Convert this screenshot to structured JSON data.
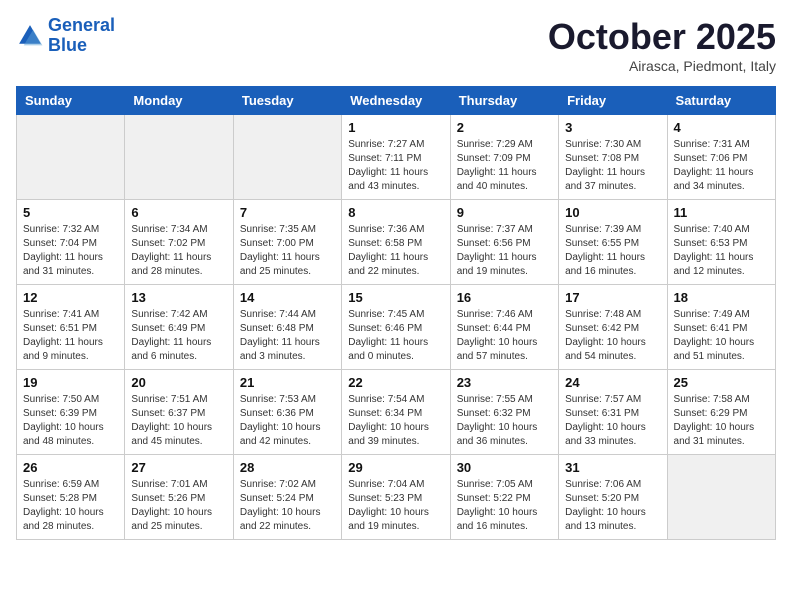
{
  "header": {
    "logo_line1": "General",
    "logo_line2": "Blue",
    "month_title": "October 2025",
    "location": "Airasca, Piedmont, Italy"
  },
  "days_of_week": [
    "Sunday",
    "Monday",
    "Tuesday",
    "Wednesday",
    "Thursday",
    "Friday",
    "Saturday"
  ],
  "weeks": [
    [
      {
        "day": "",
        "info": ""
      },
      {
        "day": "",
        "info": ""
      },
      {
        "day": "",
        "info": ""
      },
      {
        "day": "1",
        "info": "Sunrise: 7:27 AM\nSunset: 7:11 PM\nDaylight: 11 hours\nand 43 minutes."
      },
      {
        "day": "2",
        "info": "Sunrise: 7:29 AM\nSunset: 7:09 PM\nDaylight: 11 hours\nand 40 minutes."
      },
      {
        "day": "3",
        "info": "Sunrise: 7:30 AM\nSunset: 7:08 PM\nDaylight: 11 hours\nand 37 minutes."
      },
      {
        "day": "4",
        "info": "Sunrise: 7:31 AM\nSunset: 7:06 PM\nDaylight: 11 hours\nand 34 minutes."
      }
    ],
    [
      {
        "day": "5",
        "info": "Sunrise: 7:32 AM\nSunset: 7:04 PM\nDaylight: 11 hours\nand 31 minutes."
      },
      {
        "day": "6",
        "info": "Sunrise: 7:34 AM\nSunset: 7:02 PM\nDaylight: 11 hours\nand 28 minutes."
      },
      {
        "day": "7",
        "info": "Sunrise: 7:35 AM\nSunset: 7:00 PM\nDaylight: 11 hours\nand 25 minutes."
      },
      {
        "day": "8",
        "info": "Sunrise: 7:36 AM\nSunset: 6:58 PM\nDaylight: 11 hours\nand 22 minutes."
      },
      {
        "day": "9",
        "info": "Sunrise: 7:37 AM\nSunset: 6:56 PM\nDaylight: 11 hours\nand 19 minutes."
      },
      {
        "day": "10",
        "info": "Sunrise: 7:39 AM\nSunset: 6:55 PM\nDaylight: 11 hours\nand 16 minutes."
      },
      {
        "day": "11",
        "info": "Sunrise: 7:40 AM\nSunset: 6:53 PM\nDaylight: 11 hours\nand 12 minutes."
      }
    ],
    [
      {
        "day": "12",
        "info": "Sunrise: 7:41 AM\nSunset: 6:51 PM\nDaylight: 11 hours\nand 9 minutes."
      },
      {
        "day": "13",
        "info": "Sunrise: 7:42 AM\nSunset: 6:49 PM\nDaylight: 11 hours\nand 6 minutes."
      },
      {
        "day": "14",
        "info": "Sunrise: 7:44 AM\nSunset: 6:48 PM\nDaylight: 11 hours\nand 3 minutes."
      },
      {
        "day": "15",
        "info": "Sunrise: 7:45 AM\nSunset: 6:46 PM\nDaylight: 11 hours\nand 0 minutes."
      },
      {
        "day": "16",
        "info": "Sunrise: 7:46 AM\nSunset: 6:44 PM\nDaylight: 10 hours\nand 57 minutes."
      },
      {
        "day": "17",
        "info": "Sunrise: 7:48 AM\nSunset: 6:42 PM\nDaylight: 10 hours\nand 54 minutes."
      },
      {
        "day": "18",
        "info": "Sunrise: 7:49 AM\nSunset: 6:41 PM\nDaylight: 10 hours\nand 51 minutes."
      }
    ],
    [
      {
        "day": "19",
        "info": "Sunrise: 7:50 AM\nSunset: 6:39 PM\nDaylight: 10 hours\nand 48 minutes."
      },
      {
        "day": "20",
        "info": "Sunrise: 7:51 AM\nSunset: 6:37 PM\nDaylight: 10 hours\nand 45 minutes."
      },
      {
        "day": "21",
        "info": "Sunrise: 7:53 AM\nSunset: 6:36 PM\nDaylight: 10 hours\nand 42 minutes."
      },
      {
        "day": "22",
        "info": "Sunrise: 7:54 AM\nSunset: 6:34 PM\nDaylight: 10 hours\nand 39 minutes."
      },
      {
        "day": "23",
        "info": "Sunrise: 7:55 AM\nSunset: 6:32 PM\nDaylight: 10 hours\nand 36 minutes."
      },
      {
        "day": "24",
        "info": "Sunrise: 7:57 AM\nSunset: 6:31 PM\nDaylight: 10 hours\nand 33 minutes."
      },
      {
        "day": "25",
        "info": "Sunrise: 7:58 AM\nSunset: 6:29 PM\nDaylight: 10 hours\nand 31 minutes."
      }
    ],
    [
      {
        "day": "26",
        "info": "Sunrise: 6:59 AM\nSunset: 5:28 PM\nDaylight: 10 hours\nand 28 minutes."
      },
      {
        "day": "27",
        "info": "Sunrise: 7:01 AM\nSunset: 5:26 PM\nDaylight: 10 hours\nand 25 minutes."
      },
      {
        "day": "28",
        "info": "Sunrise: 7:02 AM\nSunset: 5:24 PM\nDaylight: 10 hours\nand 22 minutes."
      },
      {
        "day": "29",
        "info": "Sunrise: 7:04 AM\nSunset: 5:23 PM\nDaylight: 10 hours\nand 19 minutes."
      },
      {
        "day": "30",
        "info": "Sunrise: 7:05 AM\nSunset: 5:22 PM\nDaylight: 10 hours\nand 16 minutes."
      },
      {
        "day": "31",
        "info": "Sunrise: 7:06 AM\nSunset: 5:20 PM\nDaylight: 10 hours\nand 13 minutes."
      },
      {
        "day": "",
        "info": ""
      }
    ]
  ]
}
